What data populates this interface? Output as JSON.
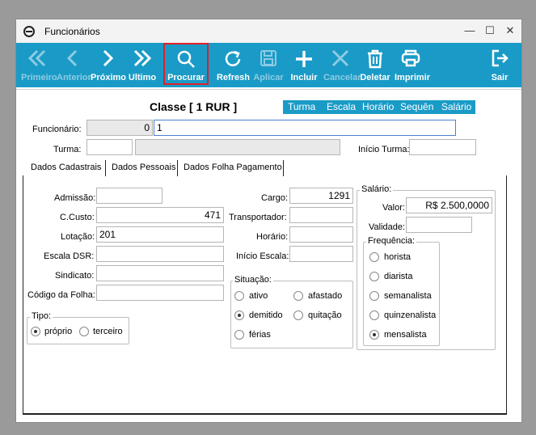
{
  "window": {
    "title": "Funcionários",
    "minimize": "—",
    "maximize": "☐",
    "close": "✕"
  },
  "toolbar": [
    {
      "label": "Primeiro",
      "icon": "double-chevron-left-icon",
      "enabled": false
    },
    {
      "label": "Anterior",
      "icon": "chevron-left-icon",
      "enabled": false
    },
    {
      "label": "Próximo",
      "icon": "chevron-right-icon",
      "enabled": true
    },
    {
      "label": "Ultimo",
      "icon": "double-chevron-right-icon",
      "enabled": true
    },
    {
      "label": "Procurar",
      "icon": "search-icon",
      "enabled": true,
      "highlighted": true
    },
    {
      "label": "Refresh",
      "icon": "refresh-icon",
      "enabled": true
    },
    {
      "label": "Aplicar",
      "icon": "save-icon",
      "enabled": false
    },
    {
      "label": "Incluir",
      "icon": "plus-icon",
      "enabled": true
    },
    {
      "label": "Cancelar",
      "icon": "x-icon",
      "enabled": false
    },
    {
      "label": "Deletar",
      "icon": "trash-icon",
      "enabled": true
    },
    {
      "label": "Imprimir",
      "icon": "printer-icon",
      "enabled": true
    },
    {
      "label": "Sair",
      "icon": "exit-icon",
      "enabled": true
    }
  ],
  "header": {
    "classe": "Classe [ 1 RUR ]",
    "links": [
      "Turma",
      "Escala",
      "Horário",
      "Sequên",
      "Salário"
    ]
  },
  "form": {
    "funcionario_label": "Funcionário:",
    "funcionario_code": "0",
    "funcionario_name": "1",
    "turma_label": "Turma:",
    "turma_code": "",
    "turma_name": "",
    "inicio_turma_label": "Início Turma:",
    "inicio_turma": ""
  },
  "tabs": [
    "Dados Cadastrais",
    "Dados Pessoais",
    "Dados Folha Pagamento"
  ],
  "cadastrais": {
    "admissao_label": "Admissão:",
    "admissao": "",
    "ccusto_label": "C.Custo:",
    "ccusto": "471",
    "lotacao_label": "Lotação:",
    "lotacao": "201",
    "escala_dsr_label": "Escala DSR:",
    "escala_dsr": "",
    "sindicato_label": "Sindicato:",
    "sindicato": "",
    "codigo_folha_label": "Código da Folha:",
    "codigo_folha": "",
    "cargo_label": "Cargo:",
    "cargo": "1291",
    "transportador_label": "Transportador:",
    "transportador": "",
    "horario_label": "Horário:",
    "horario": "",
    "inicio_escala_label": "Início Escala:",
    "inicio_escala": "",
    "tipo": {
      "title": "Tipo:",
      "options": [
        "próprio",
        "terceiro"
      ],
      "selected": "próprio"
    },
    "situacao": {
      "title": "Situação:",
      "options": [
        "ativo",
        "afastado",
        "demitido",
        "quitação",
        "férias"
      ],
      "selected": "demitido"
    },
    "salario": {
      "title": "Salário:",
      "valor_label": "Valor:",
      "valor": "R$ 2.500,0000",
      "validade_label": "Validade:",
      "validade": ""
    },
    "frequencia": {
      "title": "Frequência:",
      "options": [
        "horista",
        "diarista",
        "semanalista",
        "quinzenalista",
        "mensalista"
      ],
      "selected": "mensalista"
    }
  }
}
